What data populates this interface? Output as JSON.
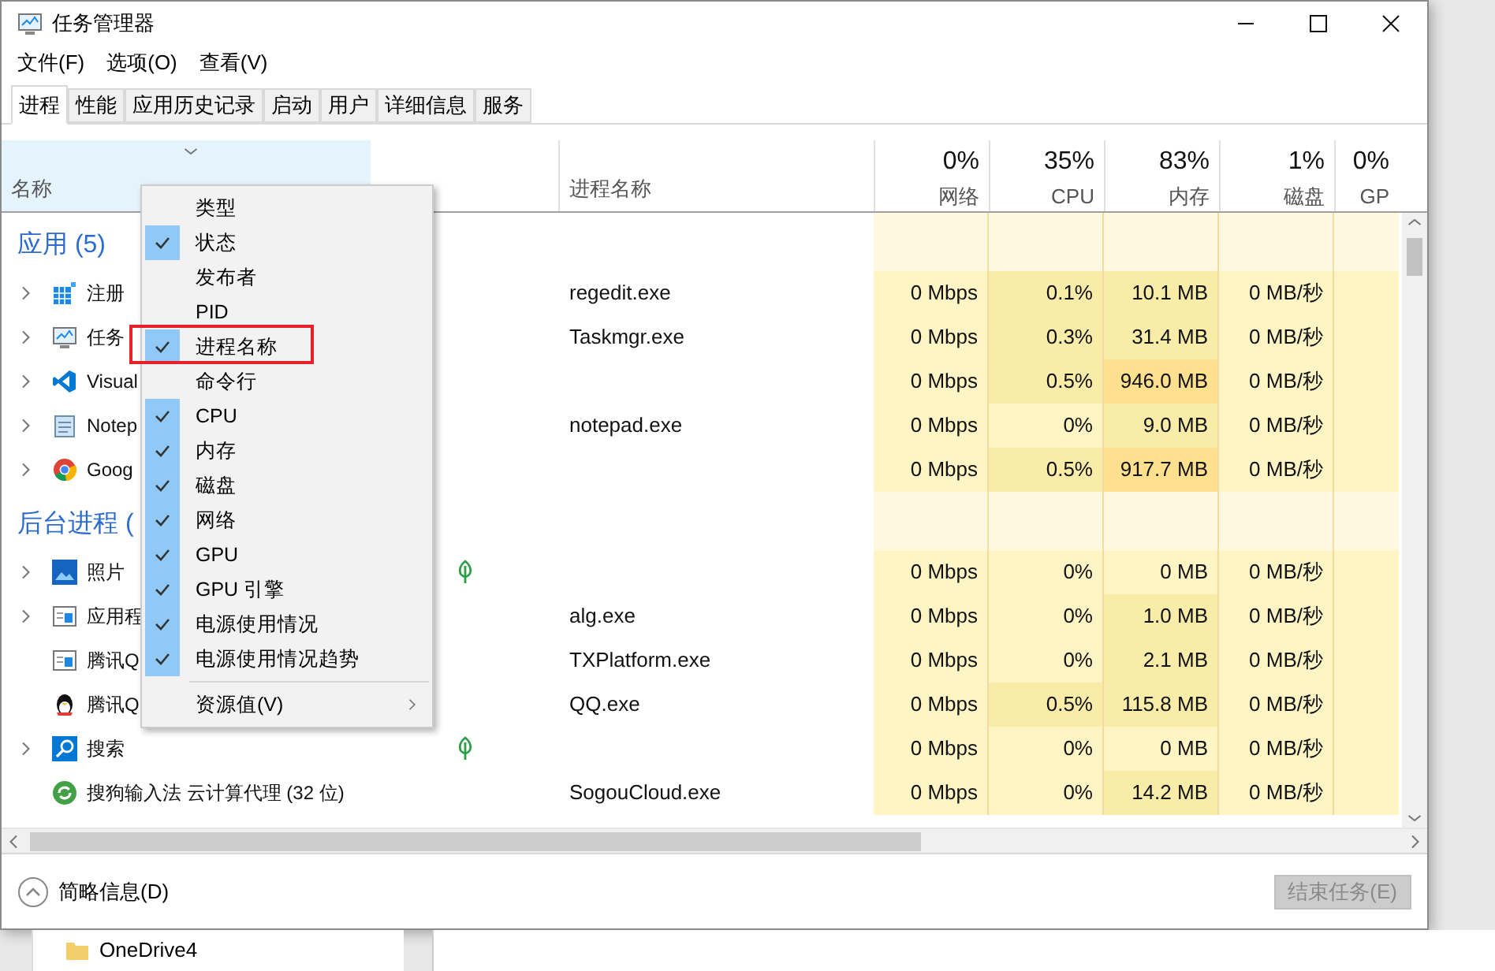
{
  "window": {
    "title": "任务管理器"
  },
  "menu_bar": [
    "文件(F)",
    "选项(O)",
    "查看(V)"
  ],
  "tabs": [
    {
      "label": "进程",
      "selected": true
    },
    {
      "label": "性能",
      "selected": false
    },
    {
      "label": "应用历史记录",
      "selected": false
    },
    {
      "label": "启动",
      "selected": false
    },
    {
      "label": "用户",
      "selected": false
    },
    {
      "label": "详细信息",
      "selected": false
    },
    {
      "label": "服务",
      "selected": false
    }
  ],
  "columns": {
    "name": "名称",
    "process_name": "进程名称",
    "metrics": [
      {
        "percent": "0%",
        "label": "网络"
      },
      {
        "percent": "35%",
        "label": "CPU"
      },
      {
        "percent": "83%",
        "label": "内存"
      },
      {
        "percent": "1%",
        "label": "磁盘"
      },
      {
        "percent": "0%",
        "label": "GP"
      }
    ]
  },
  "groups": [
    {
      "title": "应用 (5)",
      "rows": [
        {
          "kind": "regedit",
          "name": "注册",
          "expandable": true,
          "eco": false,
          "process": "regedit.exe",
          "cells": [
            {
              "text": "0 Mbps",
              "color": "#fff4c4"
            },
            {
              "text": "0.1%",
              "color": "#f9eca8"
            },
            {
              "text": "10.1 MB",
              "color": "#f9eca8"
            },
            {
              "text": "0 MB/秒",
              "color": "#fff4c4"
            }
          ]
        },
        {
          "kind": "monitor",
          "name": "任务",
          "expandable": true,
          "eco": false,
          "process": "Taskmgr.exe",
          "cells": [
            {
              "text": "0 Mbps",
              "color": "#fff4c4"
            },
            {
              "text": "0.3%",
              "color": "#f9eca8"
            },
            {
              "text": "31.4 MB",
              "color": "#f9eca8"
            },
            {
              "text": "0 MB/秒",
              "color": "#fff4c4"
            }
          ]
        },
        {
          "kind": "code",
          "name": "Visual",
          "expandable": true,
          "eco": false,
          "cells": [
            {
              "text": "0 Mbps",
              "color": "#fff4c4"
            },
            {
              "text": "0.5%",
              "color": "#f9eca8"
            },
            {
              "text": "946.0 MB",
              "color": "#ffe08f"
            },
            {
              "text": "0 MB/秒",
              "color": "#fff4c4"
            }
          ]
        },
        {
          "kind": "notepad",
          "name": "Notep",
          "expandable": true,
          "eco": false,
          "process": "notepad.exe",
          "cells": [
            {
              "text": "0 Mbps",
              "color": "#fff4c4"
            },
            {
              "text": "0%",
              "color": "#fff4c4"
            },
            {
              "text": "9.0 MB",
              "color": "#f9eca8"
            },
            {
              "text": "0 MB/秒",
              "color": "#fff4c4"
            }
          ]
        },
        {
          "kind": "browser",
          "name": "Goog",
          "expandable": true,
          "eco": false,
          "cells": [
            {
              "text": "0 Mbps",
              "color": "#fff4c4"
            },
            {
              "text": "0.5%",
              "color": "#f9eca8"
            },
            {
              "text": "917.7 MB",
              "color": "#ffe08f"
            },
            {
              "text": "0 MB/秒",
              "color": "#fff4c4"
            }
          ]
        }
      ]
    },
    {
      "title": "后台进程 (",
      "rows": [
        {
          "kind": "photo",
          "name": "照片",
          "expandable": true,
          "eco": true,
          "cells": [
            {
              "text": "0 Mbps",
              "color": "#fff4c4"
            },
            {
              "text": "0%",
              "color": "#fff4c4"
            },
            {
              "text": "0 MB",
              "color": "#fff4c4"
            },
            {
              "text": "0 MB/秒",
              "color": "#fff4c4"
            }
          ]
        },
        {
          "kind": "app-window",
          "name": "应用程",
          "expandable": true,
          "eco": false,
          "process": "alg.exe",
          "cells": [
            {
              "text": "0 Mbps",
              "color": "#fff4c4"
            },
            {
              "text": "0%",
              "color": "#fff4c4"
            },
            {
              "text": "1.0 MB",
              "color": "#f9eca8"
            },
            {
              "text": "0 MB/秒",
              "color": "#fff4c4"
            }
          ]
        },
        {
          "kind": "app-window",
          "name": "腾讯Q",
          "expandable": false,
          "eco": false,
          "process": "TXPlatform.exe",
          "cells": [
            {
              "text": "0 Mbps",
              "color": "#fff4c4"
            },
            {
              "text": "0%",
              "color": "#fff4c4"
            },
            {
              "text": "2.1 MB",
              "color": "#f9eca8"
            },
            {
              "text": "0 MB/秒",
              "color": "#fff4c4"
            }
          ]
        },
        {
          "kind": "penguin",
          "name": "腾讯Q",
          "expandable": false,
          "eco": false,
          "process": "QQ.exe",
          "cells": [
            {
              "text": "0 Mbps",
              "color": "#fff4c4"
            },
            {
              "text": "0.5%",
              "color": "#f9eca8"
            },
            {
              "text": "115.8 MB",
              "color": "#f9eca8"
            },
            {
              "text": "0 MB/秒",
              "color": "#fff4c4"
            }
          ]
        },
        {
          "kind": "search",
          "name": "搜索",
          "expandable": true,
          "eco": true,
          "cells": [
            {
              "text": "0 Mbps",
              "color": "#fff4c4"
            },
            {
              "text": "0%",
              "color": "#fff4c4"
            },
            {
              "text": "0 MB",
              "color": "#fff4c4"
            },
            {
              "text": "0 MB/秒",
              "color": "#fff4c4"
            }
          ]
        },
        {
          "kind": "cloud-app",
          "name": "搜狗输入法 云计算代理 (32 位)",
          "expandable": false,
          "eco": false,
          "process": "SogouCloud.exe",
          "cells": [
            {
              "text": "0 Mbps",
              "color": "#fff4c4"
            },
            {
              "text": "0%",
              "color": "#fff4c4"
            },
            {
              "text": "14.2 MB",
              "color": "#f9eca8"
            },
            {
              "text": "0 MB/秒",
              "color": "#fff4c4"
            }
          ]
        }
      ]
    }
  ],
  "context_menu": {
    "items": [
      {
        "label": "类型",
        "checked": false
      },
      {
        "label": "状态",
        "checked": true
      },
      {
        "label": "发布者",
        "checked": false
      },
      {
        "label": "PID",
        "checked": false
      },
      {
        "label": "进程名称",
        "checked": true
      },
      {
        "label": "命令行",
        "checked": false
      },
      {
        "label": "CPU",
        "checked": true
      },
      {
        "label": "内存",
        "checked": true
      },
      {
        "label": "磁盘",
        "checked": true
      },
      {
        "label": "网络",
        "checked": true
      },
      {
        "label": "GPU",
        "checked": true
      },
      {
        "label": "GPU 引擎",
        "checked": true
      },
      {
        "label": "电源使用情况",
        "checked": true
      },
      {
        "label": "电源使用情况趋势",
        "checked": true
      }
    ],
    "submenu": "资源值(V)"
  },
  "footer": {
    "details_toggle": "简略信息(D)",
    "end_task": {
      "label": "结束任务(E)",
      "disabled": true
    }
  },
  "background_tree": {
    "item": "OneDrive4"
  }
}
